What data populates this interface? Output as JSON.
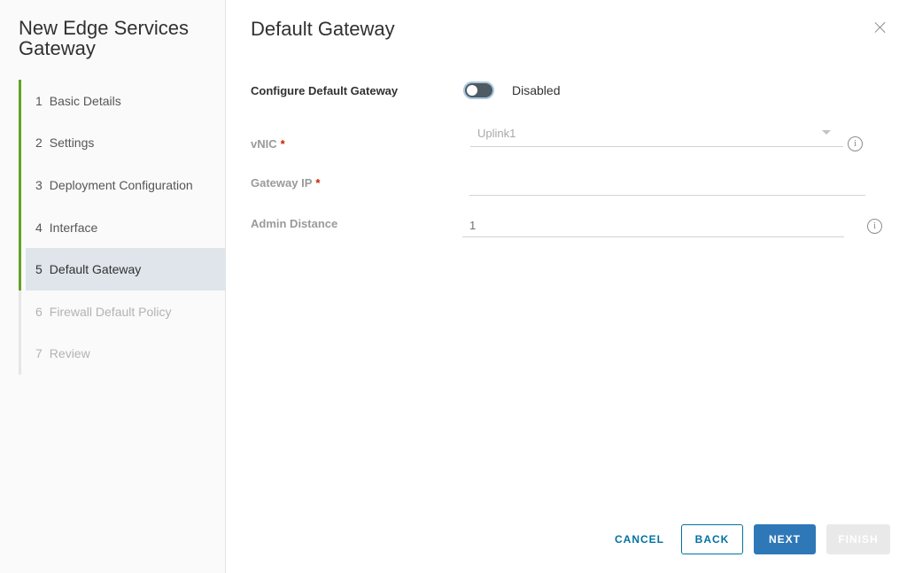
{
  "wizard": {
    "title": "New Edge Services Gateway",
    "steps": [
      {
        "num": "1",
        "label": "Basic Details",
        "state": "done"
      },
      {
        "num": "2",
        "label": "Settings",
        "state": "done"
      },
      {
        "num": "3",
        "label": "Deployment Configuration",
        "state": "done"
      },
      {
        "num": "4",
        "label": "Interface",
        "state": "done"
      },
      {
        "num": "5",
        "label": "Default Gateway",
        "state": "active"
      },
      {
        "num": "6",
        "label": "Firewall Default Policy",
        "state": "todo"
      },
      {
        "num": "7",
        "label": "Review",
        "state": "todo"
      }
    ]
  },
  "page": {
    "title": "Default Gateway",
    "close_icon": "close-icon"
  },
  "form": {
    "configure_label": "Configure Default Gateway",
    "toggle_state": "Disabled",
    "toggle_on": false,
    "vnic_label": "vNIC",
    "vnic_required": "*",
    "vnic_value": "Uplink1",
    "gateway_ip_label": "Gateway IP",
    "gateway_ip_required": "*",
    "gateway_ip_value": "",
    "admin_distance_label": "Admin Distance",
    "admin_distance_value": "1",
    "info_glyph": "i"
  },
  "footer": {
    "cancel": "CANCEL",
    "back": "BACK",
    "next": "NEXT",
    "finish": "FINISH"
  },
  "colors": {
    "accent": "#0072a3",
    "primary_button": "#2e78b8",
    "step_complete": "#62a420",
    "active_step_bg": "#dfe5ea",
    "required": "#c92100"
  }
}
